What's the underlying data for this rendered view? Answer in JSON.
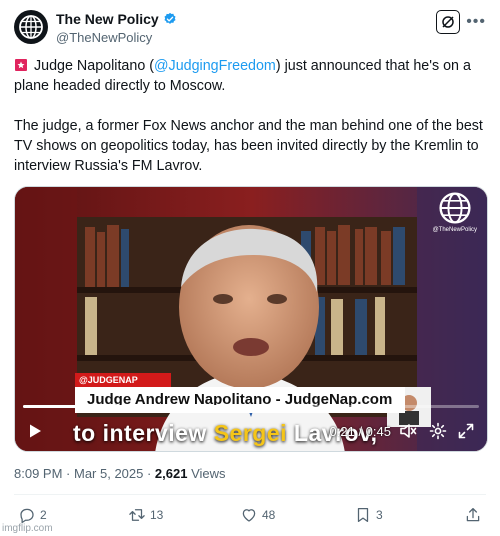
{
  "account": {
    "display_name": "The New Policy",
    "handle": "@TheNewPolicy"
  },
  "icons": {
    "avatar": "globe-icon",
    "verified": "verified-badge-icon",
    "grok": "grok-icon",
    "more": "more-icon",
    "siren": "siren-icon"
  },
  "tweet": {
    "line1_prefix": "Judge Napolitano (",
    "mention": "@JudgingFreedom",
    "line1_suffix": ") just announced that he's on a plane headed directly to Moscow.",
    "para2": "The judge, a former Fox News anchor and the man behind one of the best TV shows on geopolitics today, has been invited directly by the Kremlin to interview Russia's FM Lavrov."
  },
  "video": {
    "watermark": "@TheNewPolicy",
    "lower_tag": "@JUDGENAP",
    "lower_third": "Judge Andrew Napolitano - JudgeNap.com",
    "caption_prefix": "to interview ",
    "caption_highlight": "Sergei",
    "caption_suffix": " Lavrov,",
    "time": "0:21 / 0:45",
    "progress": 0.47
  },
  "meta": {
    "time": "8:09 PM",
    "sep": " · ",
    "date": "Mar 5, 2025",
    "views_count": "2,621",
    "views_label": " Views"
  },
  "actions": {
    "replies": "2",
    "reposts": "13",
    "likes": "48",
    "bookmarks": "3"
  },
  "watermark_site": "imgflip.com",
  "colors": {
    "link": "#1d9bf0",
    "verified": "#1d9bf0",
    "muted": "#536471"
  }
}
